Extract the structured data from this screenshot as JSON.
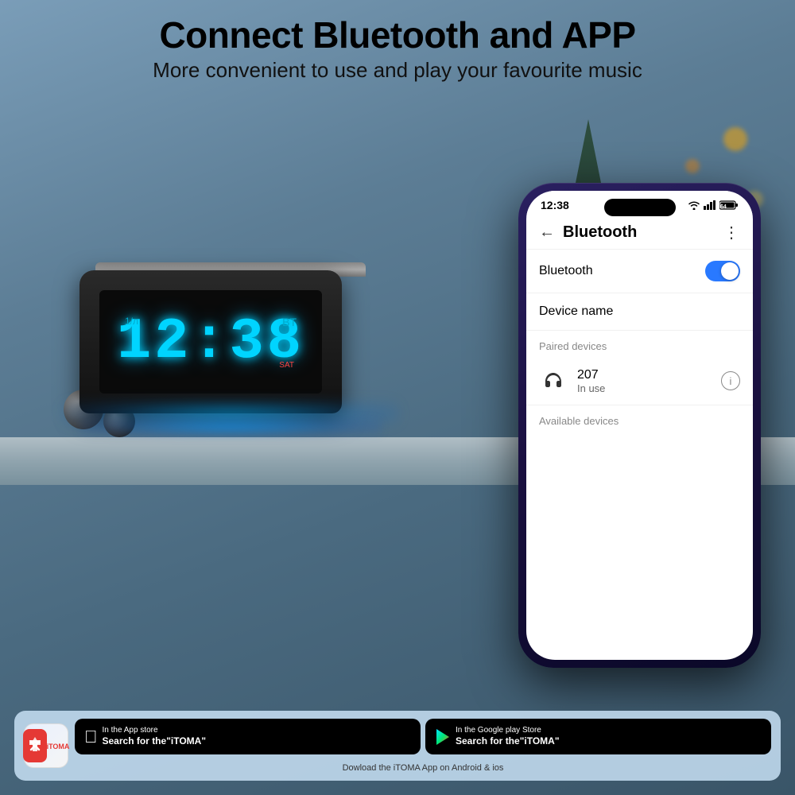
{
  "heading": {
    "main_title": "Connect Bluetooth and APP",
    "sub_title": "More convenient to use and play your favourite music"
  },
  "clock": {
    "time": "12:38",
    "bt_label": "BT",
    "ch_label": "1/л",
    "day_label": "SAT"
  },
  "phone": {
    "status_bar": {
      "time": "12:38",
      "icons": "● ▲ all 64"
    },
    "bluetooth_screen": {
      "back_label": "←",
      "title": "Bluetooth",
      "more_label": "⋮",
      "bluetooth_toggle_label": "Bluetooth",
      "device_name_label": "Device name",
      "paired_section_label": "Paired devices",
      "paired_device": {
        "name": "207",
        "status": "In use"
      },
      "available_section_label": "Available devices"
    }
  },
  "app_store": {
    "logo_name": "iTOMA",
    "apple": {
      "pre_label": "In the App store",
      "label": "Search for the\"iTOMA\""
    },
    "google": {
      "pre_label": "In the Google play Store",
      "label": "Search for the\"iTOMA\""
    },
    "download_label": "Dowload the iTOMA App on Android & ios"
  }
}
